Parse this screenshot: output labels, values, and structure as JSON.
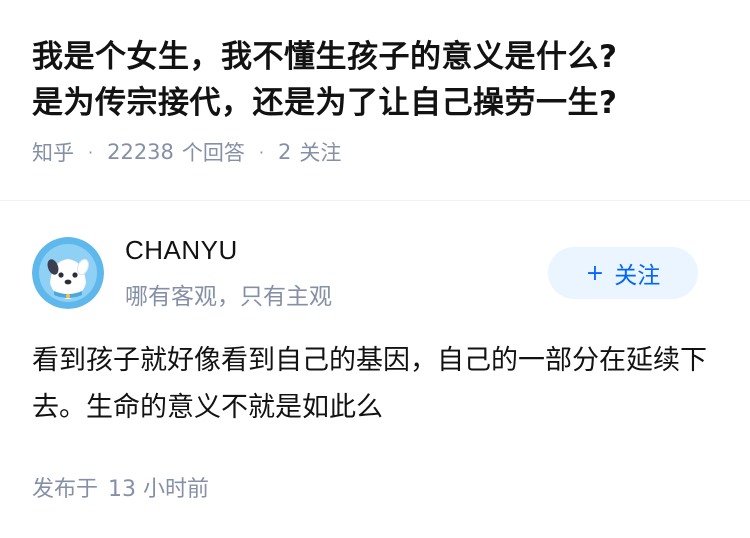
{
  "question": {
    "title_line1": "我是个女生，我不懂生孩子的意义是什么?",
    "title_line2": "是为传宗接代，还是为了让自己操劳一生?",
    "source": "知乎",
    "answer_count": "22238",
    "answer_count_label": "个回答",
    "follower_count": "2",
    "follower_label": "关注"
  },
  "answer": {
    "author_name": "CHANYU",
    "author_bio": "哪有客观，只有主观",
    "follow_plus": "+",
    "follow_label": "关注",
    "content": "看到孩子就好像看到自己的基因，自己的一部分在延续下去。生命的意义不就是如此么",
    "time_prefix": "发布于",
    "time_value": "13 小时前"
  },
  "colors": {
    "title": "#121212",
    "meta": "#8590a6",
    "accent": "#0066ff",
    "follow_bg": "#ebf5ff",
    "avatar_bg": "#5fb8ec"
  },
  "icons": {
    "avatar": "avatar-cartoon-dog"
  }
}
